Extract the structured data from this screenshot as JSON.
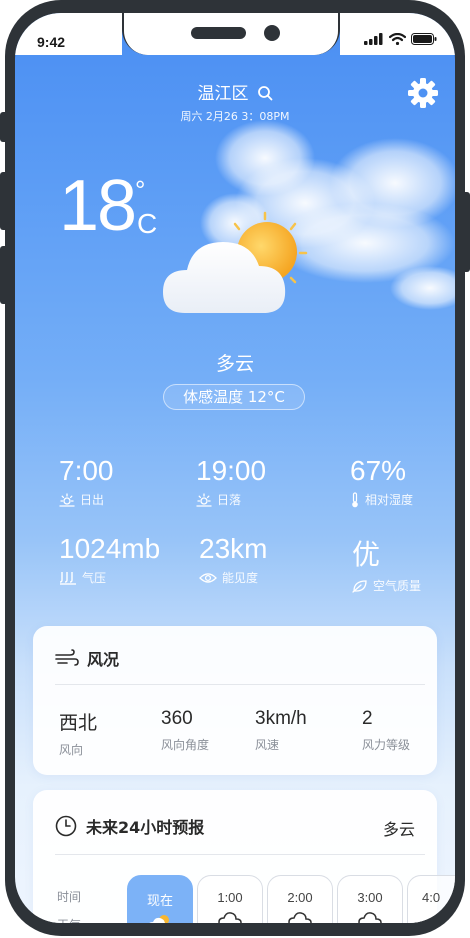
{
  "status_bar": {
    "time": "9:42"
  },
  "header": {
    "location": "温江区",
    "datetime": "周六 2月26 3：08PM"
  },
  "current": {
    "temperature": "18",
    "degree_symbol": "°",
    "unit": "C",
    "condition": "多云",
    "feels_like": "体感温度 12°C"
  },
  "stats": [
    {
      "value": "7:00",
      "label": "日出",
      "icon": "sunrise-icon"
    },
    {
      "value": "19:00",
      "label": "日落",
      "icon": "sunset-icon"
    },
    {
      "value": "67%",
      "label": "相对湿度",
      "icon": "thermometer-icon"
    },
    {
      "value": "1024mb",
      "label": "气压",
      "icon": "pressure-icon"
    },
    {
      "value": "23km",
      "label": "能见度",
      "icon": "eye-icon"
    },
    {
      "value": "优",
      "label": "空气质量",
      "icon": "leaf-icon"
    }
  ],
  "wind_card": {
    "title": "风况",
    "items": [
      {
        "value": "西北",
        "label": "风向"
      },
      {
        "value": "360",
        "label": "风向角度"
      },
      {
        "value": "3km/h",
        "label": "风速"
      },
      {
        "value": "2",
        "label": "风力等级"
      }
    ]
  },
  "forecast_card": {
    "title": "未来24小时预报",
    "summary": "多云",
    "row_labels": {
      "time": "时间",
      "weather": "天气"
    },
    "hours": [
      "现在",
      "1:00",
      "2:00",
      "3:00",
      "4:0"
    ]
  },
  "colors": {
    "sky_top": "#4a8ef2",
    "sky_bottom": "#eef5fe",
    "accent_now": "#74aef7",
    "sun": "#f7b733"
  }
}
